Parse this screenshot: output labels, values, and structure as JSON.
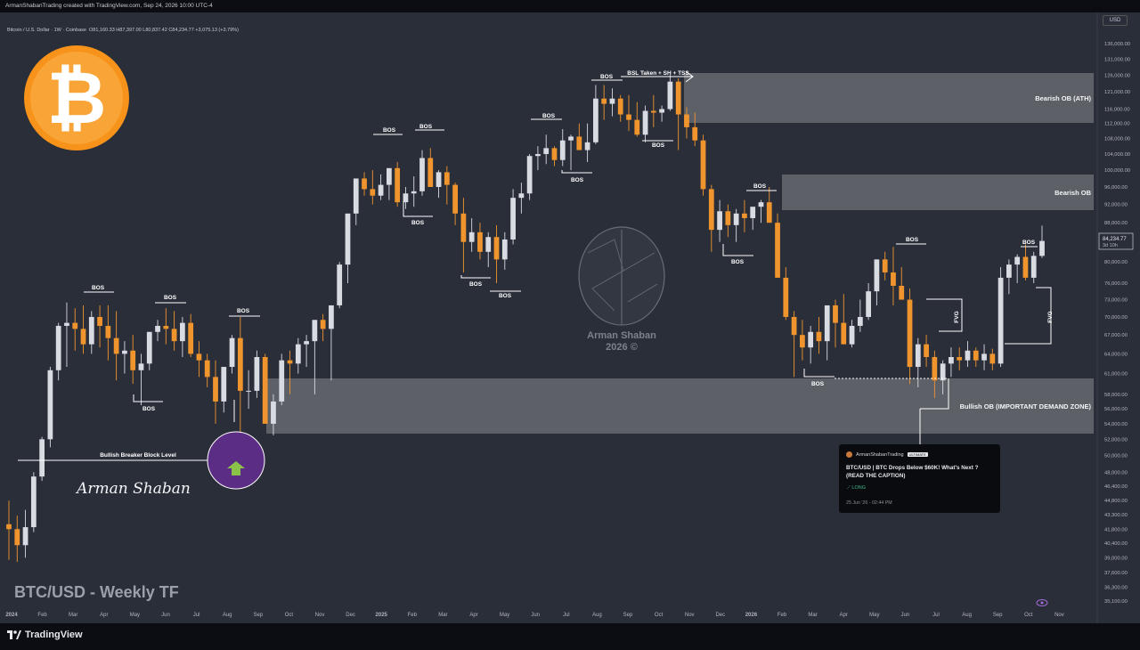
{
  "window": {
    "topbar_text": "ArmanShabanTrading created with TradingView.com, Sep 24, 2026 10:00 UTC-4",
    "symbol_line": "Bitcoin / U.S. Dollar · 1W · Coinbase",
    "ohlc_line": "O81,160.33  H87,397.00  L80,837.42  C84,234.77  +3,075.13 (+3.79%)",
    "currency": "USD",
    "brand": "TradingView"
  },
  "annotations": {
    "bsl_label": "BSL Taken + SH + TSS",
    "bos": "BOS",
    "fvg": "FVG",
    "bearish_ob_ath": "Bearish OB (ATH)",
    "bearish_ob": "Bearish OB",
    "bullish_ob": "Bullish OB (IMPORTANT DEMAND ZONE)",
    "breaker": "Bullish Breaker Block Level",
    "author_sig": "Arman Shaban",
    "watermark_name": "Arman Shaban",
    "watermark_year": "2026 ©",
    "chart_title": "BTC/USD - Weekly TF"
  },
  "post_card": {
    "author": "ArmanShabanTrading",
    "badge": "ULTIMATE",
    "title": "BTC/USD | BTC Drops Below $60K! What's Next ? (READ THE CAPTION)",
    "direction": "LONG",
    "date": "25 Jun '26 - 02:44 PM"
  },
  "price_tag": {
    "value": "84,234.77",
    "countdown": "3d 10h"
  },
  "colors": {
    "bull": "#d9dbe2",
    "bear": "#f0952e",
    "bg": "#2a2e39",
    "zone": "#6b6e75"
  },
  "chart_data": {
    "type": "candlestick",
    "title": "BTC/USD - Weekly TF",
    "scale": "log",
    "y_ticks": [
      136000,
      131000,
      126000,
      121000,
      116000,
      112000,
      108000,
      104000,
      100000,
      96000,
      92000,
      88000,
      84000,
      80000,
      76000,
      73000,
      70000,
      67000,
      64000,
      61000,
      58000,
      56000,
      54000,
      52000,
      50000,
      48000,
      46400,
      44800,
      43300,
      41800,
      40400,
      39000,
      37600,
      36300,
      35100
    ],
    "y_tick_labels": [
      "136,000.00",
      "131,000.00",
      "126,000.00",
      "121,000.00",
      "116,000.00",
      "112,000.00",
      "108,000.00",
      "104,000.00",
      "100,000.00",
      "96,000.00",
      "92,000.00",
      "88,000.00",
      "84,000.00",
      "80,000.00",
      "76,000.00",
      "73,000.00",
      "70,000.00",
      "67,000.00",
      "64,000.00",
      "61,000.00",
      "58,000.00",
      "56,000.00",
      "54,000.00",
      "52,000.00",
      "50,000.00",
      "48,000.00",
      "46,400.00",
      "44,800.00",
      "43,300.00",
      "41,800.00",
      "40,400.00",
      "39,000.00",
      "37,600.00",
      "36,300.00",
      "35,100.00"
    ],
    "x_labels": [
      "2024",
      "Feb",
      "Mar",
      "Apr",
      "May",
      "Jun",
      "Jul",
      "Aug",
      "Sep",
      "Oct",
      "Nov",
      "Dec",
      "2025",
      "Feb",
      "Mar",
      "Apr",
      "May",
      "Jun",
      "Jul",
      "Aug",
      "Sep",
      "Oct",
      "Nov",
      "Dec",
      "2026",
      "Feb",
      "Mar",
      "Apr",
      "May",
      "Jun",
      "Jul",
      "Aug",
      "Sep",
      "Oct",
      "Nov"
    ],
    "x_bold": [
      "2024",
      "2025",
      "2026"
    ],
    "ohlc": [
      [
        42300,
        44800,
        38800,
        41800
      ],
      [
        41800,
        43200,
        38600,
        40200
      ],
      [
        40200,
        43800,
        39000,
        42000
      ],
      [
        42000,
        48000,
        41500,
        47500
      ],
      [
        47500,
        52300,
        47000,
        52000
      ],
      [
        52000,
        62000,
        51000,
        61500
      ],
      [
        61500,
        69000,
        60000,
        68500
      ],
      [
        68500,
        72500,
        62000,
        69000
      ],
      [
        69000,
        71500,
        64500,
        68000
      ],
      [
        68000,
        72000,
        64000,
        65500
      ],
      [
        65500,
        71000,
        64000,
        70000
      ],
      [
        70000,
        72000,
        65000,
        68500
      ],
      [
        68500,
        72000,
        63000,
        66500
      ],
      [
        66500,
        71000,
        60000,
        64000
      ],
      [
        64000,
        66000,
        61000,
        64500
      ],
      [
        64500,
        67000,
        59500,
        61500
      ],
      [
        61500,
        64000,
        56500,
        62500
      ],
      [
        62500,
        67500,
        61500,
        67500
      ],
      [
        67500,
        69500,
        66000,
        68500
      ],
      [
        68500,
        71500,
        65500,
        68000
      ],
      [
        68000,
        71000,
        64500,
        66000
      ],
      [
        66000,
        70000,
        63500,
        69000
      ],
      [
        69000,
        70500,
        63500,
        64000
      ],
      [
        64000,
        66000,
        60500,
        63000
      ],
      [
        63000,
        64000,
        59000,
        60500
      ],
      [
        60500,
        63000,
        54000,
        57000
      ],
      [
        57000,
        62000,
        55500,
        62000
      ],
      [
        62000,
        67000,
        61000,
        66500
      ],
      [
        66500,
        70000,
        49000,
        58500
      ],
      [
        58500,
        61500,
        56000,
        58500
      ],
      [
        58500,
        64500,
        57500,
        63500
      ],
      [
        63500,
        64000,
        56000,
        54000
      ],
      [
        54000,
        58000,
        52500,
        57000
      ],
      [
        57000,
        64000,
        56500,
        63000
      ],
      [
        63000,
        64500,
        58000,
        62500
      ],
      [
        62500,
        66500,
        61000,
        65500
      ],
      [
        65500,
        67000,
        62000,
        66000
      ],
      [
        66000,
        69000,
        58000,
        69500
      ],
      [
        69500,
        70500,
        66000,
        68000
      ],
      [
        68000,
        69000,
        60000,
        72000
      ],
      [
        72000,
        80000,
        71500,
        79500
      ],
      [
        79500,
        85000,
        76000,
        90000
      ],
      [
        90000,
        93000,
        87500,
        98000
      ],
      [
        98000,
        99500,
        94000,
        95500
      ],
      [
        95500,
        100000,
        92000,
        94000
      ],
      [
        94000,
        99000,
        93000,
        96500
      ],
      [
        96500,
        99500,
        93000,
        100500
      ],
      [
        100500,
        102000,
        91500,
        92500
      ],
      [
        92500,
        96000,
        91000,
        94500
      ],
      [
        94500,
        98500,
        91500,
        95000
      ],
      [
        95000,
        105000,
        94000,
        103000
      ],
      [
        103000,
        105500,
        96000,
        96000
      ],
      [
        96000,
        100000,
        93500,
        99500
      ],
      [
        99500,
        101000,
        92000,
        96500
      ],
      [
        96500,
        97000,
        87500,
        90000
      ],
      [
        90000,
        93500,
        78000,
        84000
      ],
      [
        84000,
        89000,
        82000,
        86000
      ],
      [
        86000,
        88000,
        80500,
        82000
      ],
      [
        82000,
        86000,
        79000,
        85000
      ],
      [
        85000,
        87500,
        76000,
        80500
      ],
      [
        80500,
        86000,
        78500,
        84500
      ],
      [
        84500,
        95500,
        83500,
        93500
      ],
      [
        93500,
        97000,
        90000,
        94500
      ],
      [
        94500,
        104000,
        93000,
        103500
      ],
      [
        103500,
        106000,
        100000,
        104000
      ],
      [
        104000,
        109000,
        101500,
        105500
      ],
      [
        105500,
        106000,
        101000,
        102500
      ],
      [
        102500,
        110500,
        101000,
        107500
      ],
      [
        107500,
        109000,
        100000,
        108500
      ],
      [
        108500,
        112000,
        105000,
        105000
      ],
      [
        105000,
        112000,
        102000,
        107000
      ],
      [
        107000,
        123000,
        106500,
        119000
      ],
      [
        119000,
        123000,
        113000,
        117500
      ],
      [
        117500,
        122000,
        114000,
        119000
      ],
      [
        119000,
        120000,
        112500,
        114500
      ],
      [
        114500,
        120000,
        110000,
        113000
      ],
      [
        113000,
        118000,
        108500,
        109000
      ],
      [
        109000,
        117000,
        107000,
        115500
      ],
      [
        115500,
        120000,
        111000,
        115000
      ],
      [
        115000,
        117000,
        112500,
        116000
      ],
      [
        116000,
        126000,
        115500,
        124000
      ],
      [
        124000,
        125000,
        105000,
        114500
      ],
      [
        114500,
        116500,
        108000,
        111000
      ],
      [
        111000,
        115000,
        106000,
        107500
      ],
      [
        107500,
        109000,
        94000,
        95500
      ],
      [
        95500,
        96500,
        82000,
        86500
      ],
      [
        86500,
        93000,
        84000,
        90500
      ],
      [
        90500,
        92000,
        85000,
        87500
      ],
      [
        87500,
        91000,
        84000,
        90000
      ],
      [
        90000,
        93000,
        86000,
        89000
      ],
      [
        89000,
        91000,
        86500,
        91500
      ],
      [
        91500,
        93000,
        88000,
        92500
      ],
      [
        92500,
        96000,
        89000,
        88000
      ],
      [
        88000,
        90000,
        81000,
        77000
      ],
      [
        77000,
        79000,
        69500,
        70000
      ],
      [
        70000,
        71000,
        60500,
        67000
      ],
      [
        67000,
        69500,
        63000,
        65000
      ],
      [
        65000,
        68500,
        62500,
        67500
      ],
      [
        67500,
        70000,
        64000,
        66000
      ],
      [
        66000,
        69000,
        63000,
        72000
      ],
      [
        72000,
        73000,
        65000,
        69000
      ],
      [
        69000,
        74000,
        66000,
        65500
      ],
      [
        65500,
        69500,
        65000,
        68500
      ],
      [
        68500,
        73000,
        67500,
        70000
      ],
      [
        70000,
        76000,
        69500,
        74500
      ],
      [
        74500,
        80500,
        72000,
        80500
      ],
      [
        80500,
        82000,
        76500,
        78000
      ],
      [
        78000,
        83000,
        72000,
        75500
      ],
      [
        75500,
        79000,
        73500,
        73000
      ],
      [
        73000,
        75000,
        59500,
        62000
      ],
      [
        62000,
        66500,
        59000,
        65500
      ],
      [
        65500,
        67000,
        62000,
        63500
      ],
      [
        63500,
        64500,
        57500,
        60000
      ],
      [
        60000,
        63000,
        58000,
        62500
      ],
      [
        62500,
        65000,
        60500,
        63500
      ],
      [
        63500,
        65000,
        61500,
        63000
      ],
      [
        63000,
        66000,
        62000,
        64500
      ],
      [
        64500,
        65000,
        62000,
        63000
      ],
      [
        63000,
        65500,
        61500,
        64000
      ],
      [
        64000,
        64800,
        61500,
        62500
      ],
      [
        62500,
        79000,
        62000,
        77000
      ],
      [
        77000,
        80500,
        74000,
        79500
      ],
      [
        79500,
        81500,
        76000,
        81000
      ],
      [
        81000,
        83500,
        76500,
        77000
      ],
      [
        77000,
        82000,
        76000,
        81200
      ],
      [
        81200,
        87400,
        80800,
        84200
      ]
    ]
  }
}
